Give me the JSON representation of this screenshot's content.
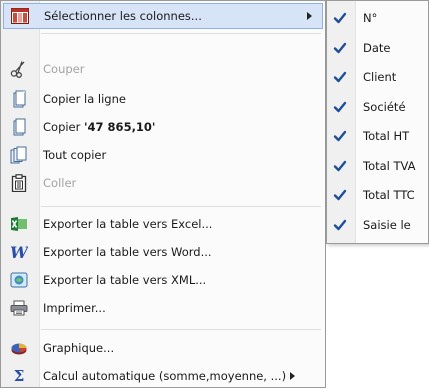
{
  "menu": {
    "items": [
      {
        "label": "Sélectionner les colonnes...",
        "icon": "columns-icon"
      },
      {
        "label": "Couper",
        "icon": "scissors-icon"
      },
      {
        "label": "Copier la ligne",
        "icon": "copy-icon"
      },
      {
        "label_prefix": "Copier ",
        "label_value": "'47 865,10'",
        "icon": "copy-icon"
      },
      {
        "label": "Tout copier",
        "icon": "copy-all-icon"
      },
      {
        "label": "Coller",
        "icon": "paste-icon"
      },
      {
        "label": "Exporter la table vers Excel...",
        "icon": "excel-icon"
      },
      {
        "label": "Exporter la table vers Word...",
        "icon": "word-icon"
      },
      {
        "label": "Exporter la table vers XML...",
        "icon": "xml-icon"
      },
      {
        "label": "Imprimer...",
        "icon": "printer-icon"
      },
      {
        "label": "Graphique...",
        "icon": "pie-chart-icon"
      },
      {
        "label": "Calcul automatique (somme,moyenne, ...)",
        "icon": "sigma-icon"
      }
    ]
  },
  "submenu": {
    "items": [
      {
        "label": "N°",
        "checked": true
      },
      {
        "label": "Date",
        "checked": true
      },
      {
        "label": "Client",
        "checked": true
      },
      {
        "label": "Société",
        "checked": true
      },
      {
        "label": "Total HT",
        "checked": true
      },
      {
        "label": "Total TVA",
        "checked": true
      },
      {
        "label": "Total TTC",
        "checked": true
      },
      {
        "label": "Saisie le",
        "checked": true
      }
    ]
  },
  "colors": {
    "highlight": "#d7e4f7",
    "highlight_border": "#8fb2e0",
    "check": "#1f4e9a",
    "disabled_text": "#a3a3a3"
  }
}
